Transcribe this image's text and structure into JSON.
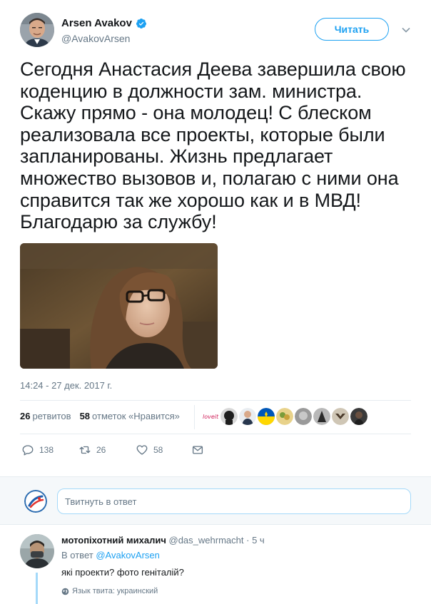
{
  "tweet": {
    "author": {
      "name": "Arsen Avakov",
      "handle": "@AvakovArsen",
      "verified": true
    },
    "follow_label": "Читать",
    "text_lines": [
      "Сегодня Анастасия Деева завершила свою",
      "коденцию в должности зам. министра.",
      "Скажу прямо - она молодец! С блеском",
      "реализовала все проекты, которые были",
      "запланированы. Жизнь предлагает",
      "множество вызовов и, полагаю с ними она",
      "справится так же хорошо как и в МВД!",
      "Благодарю за службу!"
    ],
    "timestamp": "14:24 - 27 дек. 2017 г.",
    "stats": {
      "retweets_count": "26",
      "retweets_label": "ретвитов",
      "likes_count": "58",
      "likes_label": "отметок «Нравится»"
    },
    "actions": {
      "replies": "138",
      "retweets": "26",
      "likes": "58"
    }
  },
  "reply_box": {
    "placeholder": "Твитнуть в ответ"
  },
  "comment": {
    "name": "мотопіхотний михалич",
    "handle": "@das_wehrmacht",
    "time": "5 ч",
    "in_reply_prefix": "В ответ",
    "in_reply_mention": "@AvakovArsen",
    "text": "які проекти? фото геніталій?",
    "language": "Язык твита: украинский"
  },
  "icons": {
    "verified": "verified-badge-icon",
    "caret": "chevron-down-icon",
    "reply": "reply-icon",
    "retweet": "retweet-icon",
    "like": "heart-icon",
    "message": "envelope-icon",
    "globe": "globe-icon"
  },
  "colors": {
    "accent": "#1da1f2",
    "muted": "#657786",
    "text": "#14171a",
    "reply_bg": "#f5f8fa",
    "thread_line": "#a4d9f9"
  }
}
